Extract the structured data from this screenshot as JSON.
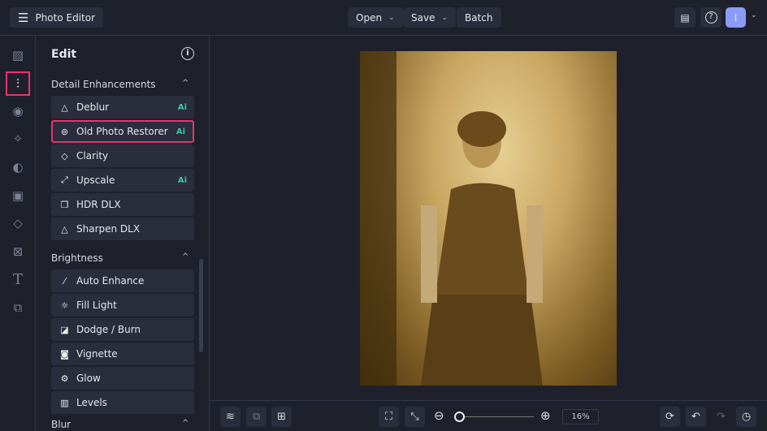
{
  "header": {
    "app_title": "Photo Editor",
    "open_label": "Open",
    "save_label": "Save",
    "batch_label": "Batch",
    "avatar_initial": "I"
  },
  "panel": {
    "title": "Edit",
    "sections": [
      {
        "title": "Detail Enhancements",
        "items": [
          {
            "label": "Deblur",
            "ai": "Ai"
          },
          {
            "label": "Old Photo Restorer",
            "ai": "Ai"
          },
          {
            "label": "Clarity"
          },
          {
            "label": "Upscale",
            "ai": "Ai"
          },
          {
            "label": "HDR DLX"
          },
          {
            "label": "Sharpen DLX"
          }
        ]
      },
      {
        "title": "Brightness",
        "items": [
          {
            "label": "Auto Enhance"
          },
          {
            "label": "Fill Light"
          },
          {
            "label": "Dodge / Burn"
          },
          {
            "label": "Vignette"
          },
          {
            "label": "Glow"
          },
          {
            "label": "Levels"
          }
        ]
      },
      {
        "title": "Blur"
      }
    ]
  },
  "footer": {
    "zoom": "16%"
  },
  "colors": {
    "accent": "#e8336f",
    "ai": "#3ec9a7",
    "avatar": "#8c9bf5"
  }
}
